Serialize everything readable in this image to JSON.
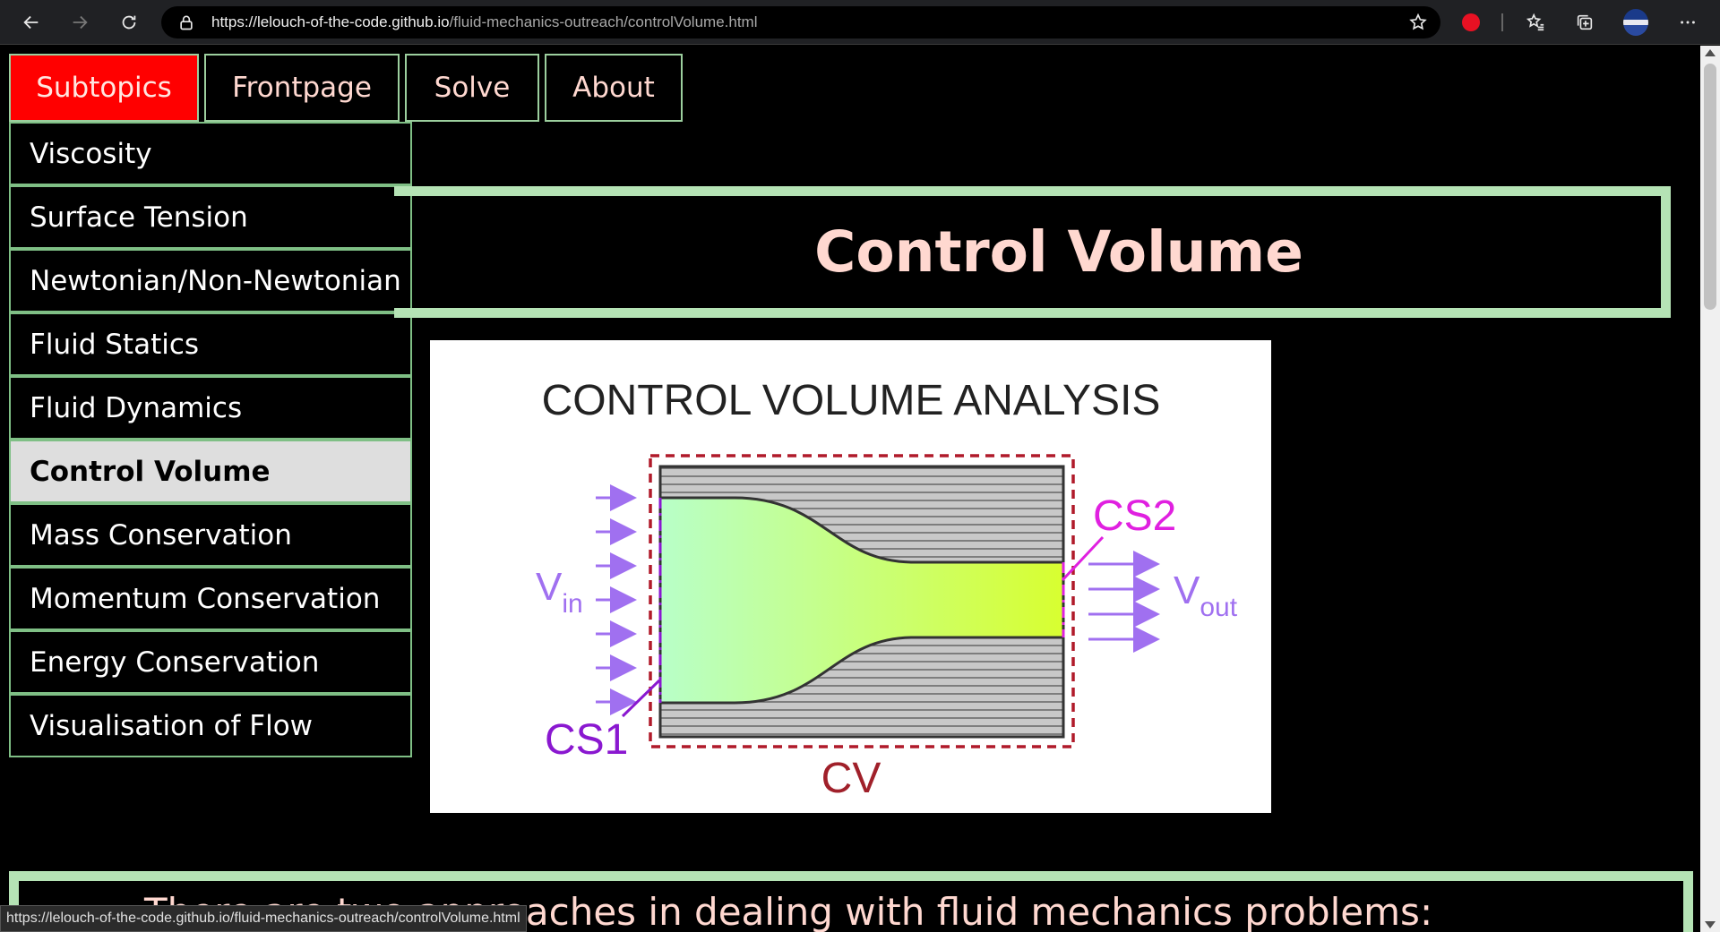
{
  "browser": {
    "url_host": "https://lelouch-of-the-code.github.io",
    "url_path": "/fluid-mechanics-outreach/controlVolume.html",
    "status_url": "https://lelouch-of-the-code.github.io/fluid-mechanics-outreach/controlVolume.html",
    "icons": [
      "back-icon",
      "forward-icon",
      "refresh-icon",
      "lock-icon",
      "add-favorite-icon",
      "extension-stop-icon",
      "favorites-icon",
      "collections-icon",
      "profile-avatar",
      "more-icon"
    ]
  },
  "topnav": {
    "items": [
      {
        "label": "Subtopics",
        "active": true
      },
      {
        "label": "Frontpage",
        "active": false
      },
      {
        "label": "Solve",
        "active": false
      },
      {
        "label": "About",
        "active": false
      }
    ]
  },
  "sidemenu": {
    "items": [
      {
        "label": "Viscosity"
      },
      {
        "label": "Surface Tension"
      },
      {
        "label": "Newtonian/Non-Newtonian"
      },
      {
        "label": "Fluid Statics"
      },
      {
        "label": "Fluid Dynamics"
      },
      {
        "label": "Control Volume",
        "current": true
      },
      {
        "label": "Mass Conservation"
      },
      {
        "label": "Momentum Conservation"
      },
      {
        "label": "Energy Conservation"
      },
      {
        "label": "Visualisation of Flow"
      }
    ]
  },
  "page": {
    "title": "Control Volume",
    "bottom_text": "There are two approaches in dealing with fluid mechanics problems:"
  },
  "figure": {
    "heading": "CONTROL VOLUME ANALYSIS",
    "v_in": "V",
    "v_in_sub": "in",
    "v_out": "V",
    "v_out_sub": "out",
    "cs1": "CS1",
    "cs2": "CS2",
    "cv": "CV"
  },
  "colors": {
    "accent_red": "#ff0000",
    "border_green": "#b5e3b5",
    "title_pink": "#ffd8d0",
    "arrow_purple": "#a070f0",
    "cs_magenta": "#e020e0",
    "cs1_purple": "#8a18d0",
    "cv_red": "#a0202a"
  }
}
